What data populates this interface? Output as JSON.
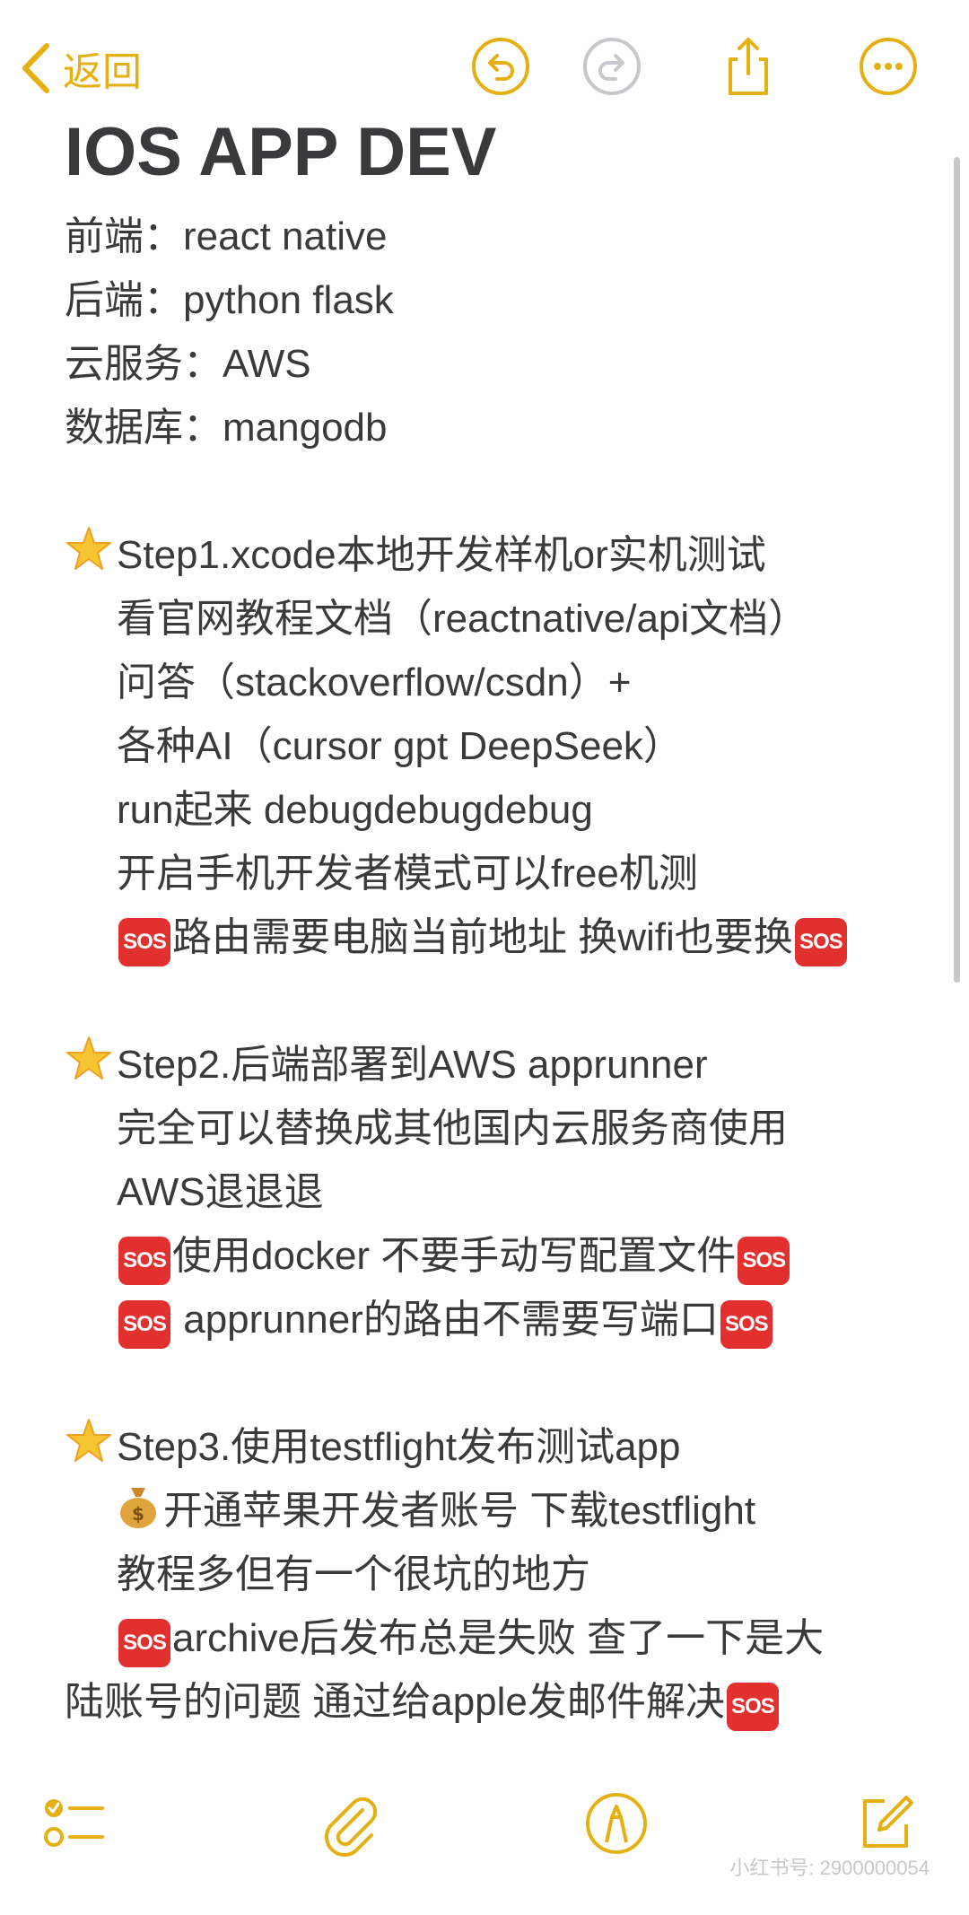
{
  "nav": {
    "back_label": "返回"
  },
  "note": {
    "title": "IOS APP DEV",
    "stack": [
      "前端：react native",
      "后端：python flask",
      "云服务：AWS",
      "数据库：mangodb"
    ],
    "step1": {
      "heading": "Step1.xcode本地开发样机or实机测试",
      "lines": [
        "看官网教程文档（reactnative/api文档）",
        "问答（stackoverflow/csdn）+",
        "各种AI（cursor gpt DeepSeek）",
        "run起来 debugdebugdebug",
        "开启手机开发者模式可以free机测"
      ],
      "warn": "路由需要电脑当前地址 换wifi也要换"
    },
    "step2": {
      "heading": "Step2.后端部署到AWS apprunner",
      "lines": [
        "完全可以替换成其他国内云服务商使用",
        "AWS退退退"
      ],
      "warn1": "使用docker 不要手动写配置文件",
      "warn2": " apprunner的路由不需要写端口"
    },
    "step3": {
      "heading": "Step3.使用testflight发布测试app",
      "account": "开通苹果开发者账号 下载testflight",
      "line": "教程多但有一个很坑的地方",
      "warn_a": "archive后发布总是失败 查了一下是大",
      "warn_b": "陆账号的问题 通过给apple发邮件解决"
    },
    "sos_label": "SOS"
  },
  "watermark": "小红书号: 2900000054",
  "icons": {
    "back": "chevron-left-icon",
    "undo": "undo-icon",
    "redo": "redo-icon",
    "share": "share-icon",
    "more": "more-icon",
    "checklist": "checklist-icon",
    "attach": "paperclip-icon",
    "markup": "markup-pen-icon",
    "compose": "compose-icon",
    "star": "glowing-star-emoji",
    "moneybag": "money-bag-emoji",
    "sos": "sos-emoji"
  },
  "colors": {
    "accent": "#e4b012",
    "text": "#3a3a3c",
    "sos": "#e2302f",
    "disabled": "#c7c7cc"
  }
}
